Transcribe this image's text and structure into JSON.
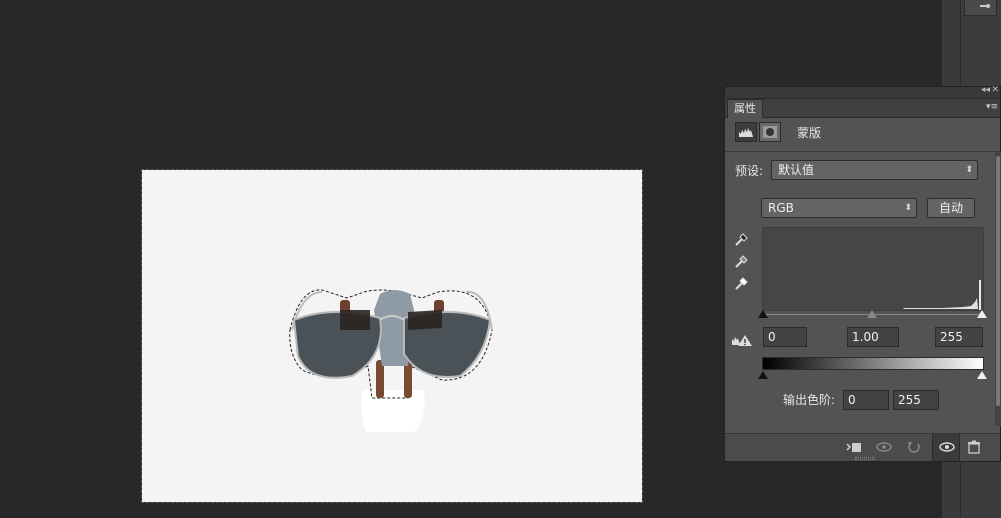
{
  "panel": {
    "tab_label": "属性",
    "adjustment_type_label": "蒙版",
    "preset_label": "预设:",
    "preset_value": "默认值",
    "channel_value": "RGB",
    "auto_button": "自动",
    "input_black": "0",
    "input_gamma": "1.00",
    "input_white": "255",
    "output_label": "输出色阶:",
    "output_black": "0",
    "output_white": "255"
  },
  "colors": {
    "canvas_bg": "#282828",
    "panel_bg": "#535353",
    "document_bg": "#f4f4f4"
  },
  "icons": {
    "levels": "levels-histogram-icon",
    "mask": "layer-mask-icon",
    "black_eyedropper": "eyedropper-black-icon",
    "gray_eyedropper": "eyedropper-gray-icon",
    "white_eyedropper": "eyedropper-white-icon",
    "clip": "clip-to-layer-icon",
    "view_previous": "view-previous-icon",
    "reset": "reset-icon",
    "visibility": "eye-icon",
    "delete": "trash-icon"
  }
}
